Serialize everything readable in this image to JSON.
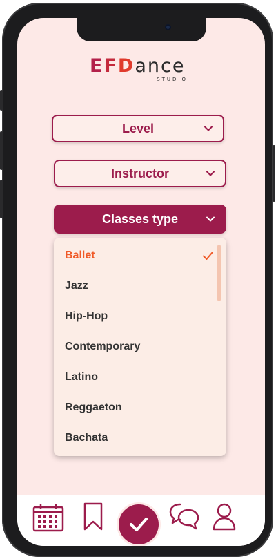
{
  "brand": {
    "logo_e": "E",
    "logo_f": "F",
    "logo_d": "D",
    "logo_rest": "ance",
    "logo_sub": "STUDIO"
  },
  "filters": {
    "level_label": "Level",
    "instructor_label": "Instructor",
    "classes_type_label": "Classes type"
  },
  "dropdown": {
    "options": [
      "Ballet",
      "Jazz",
      "Hip-Hop",
      "Contemporary",
      "Latino",
      "Reggaeton",
      "Bachata"
    ],
    "selected": "Ballet"
  },
  "tabbar": {
    "items": [
      "calendar-icon",
      "bookmark-icon",
      "check-icon",
      "chat-icon",
      "user-icon"
    ]
  },
  "colors": {
    "accent": "#9c1c4c",
    "selected_option": "#f05a28",
    "background": "#fde9e7"
  }
}
